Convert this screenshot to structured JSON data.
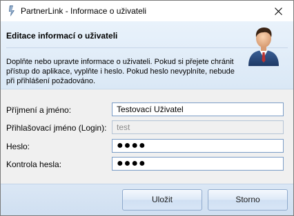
{
  "window": {
    "title": "PartnerLink - Informace o uživateli"
  },
  "header": {
    "title": "Editace informací o uživateli",
    "description_line1": "Doplňte nebo upravte informace o uživateli. Pokud si přejete chránit",
    "description_line2": "přístup do aplikace, vyplňte i heslo. Pokud heslo nevyplníte, nebude",
    "description_line3": "při přihlášení požadováno."
  },
  "form": {
    "fullname": {
      "label": "Příjmení a jméno:",
      "value": "Testovací Uživatel"
    },
    "login": {
      "label": "Přihlašovací jméno (Login):",
      "value": "test"
    },
    "password": {
      "label": "Heslo:",
      "value": "●●●●"
    },
    "password_confirm": {
      "label": "Kontrola hesla:",
      "value": "●●●●"
    }
  },
  "buttons": {
    "save": "Uložit",
    "cancel": "Storno"
  },
  "colors": {
    "header_bg": "#dae8f6",
    "footer_bg": "#d4e3f4",
    "input_border": "#7a9cc6"
  },
  "icons": {
    "app": "partnerlink-app-icon",
    "user": "business-user-icon",
    "close": "close-icon"
  }
}
